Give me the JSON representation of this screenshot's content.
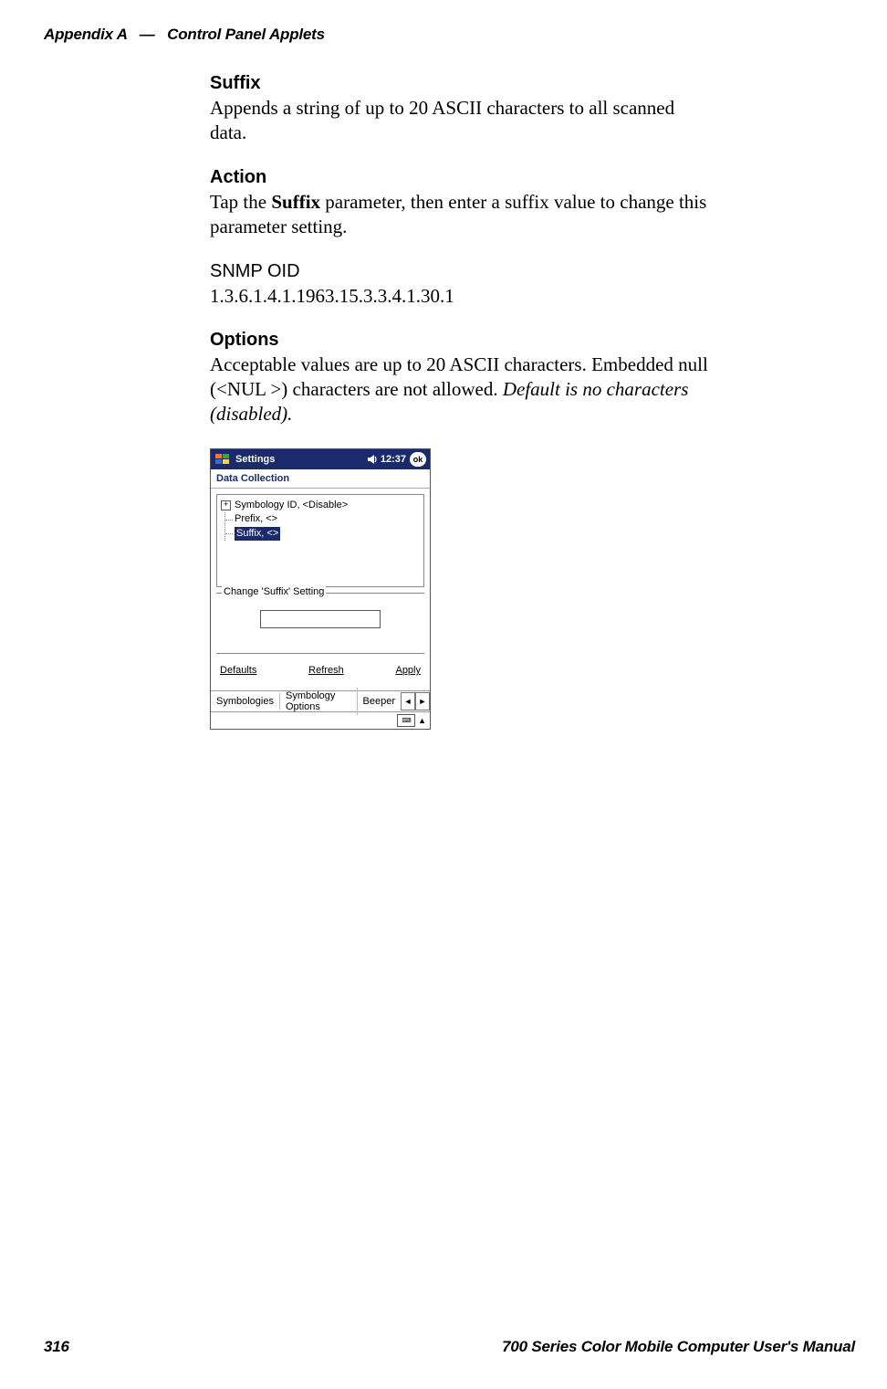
{
  "header": {
    "appendix": "Appendix  A",
    "sep": "—",
    "title": "Control Panel Applets"
  },
  "sections": {
    "suffix": {
      "heading": "Suffix",
      "text": "Appends a string of up to 20 ASCII characters to all scanned data."
    },
    "action": {
      "heading": "Action",
      "pre": "Tap the ",
      "bold": "Suffix",
      "post": " parameter, then enter a suffix value to change this parame­ter setting."
    },
    "snmp": {
      "heading": "SNMP OID",
      "oid": "1.3.6.1.4.1.1963.15.3.3.4.1.30.1"
    },
    "options": {
      "heading": "Options",
      "pre": "Acceptable values are up to 20 ASCII characters. Embedded null (<NUL >) characters are not allowed. ",
      "italic": "Default is no characters (disabled)."
    }
  },
  "device": {
    "titlebar": {
      "title": "Settings",
      "clock": "12:37",
      "ok": "ok"
    },
    "apptitle": "Data Collection",
    "tree": {
      "item0": "Symbology ID, <Disable>",
      "item1": "Prefix, <>",
      "item2": "Suffix, <>"
    },
    "fieldset": {
      "legend": "Change 'Suffix' Setting"
    },
    "buttons": {
      "defaults": "Defaults",
      "refresh": "Refresh",
      "apply": "Apply"
    },
    "tabs": {
      "t0": "Symbologies",
      "t1": "Symbology Options",
      "t2": "Beeper",
      "left": "◄",
      "right": "►"
    },
    "sip": {
      "up": "▲",
      "kbd": "⌨"
    }
  },
  "footer": {
    "page": "316",
    "manual": "700 Series Color Mobile Computer User's Manual"
  }
}
